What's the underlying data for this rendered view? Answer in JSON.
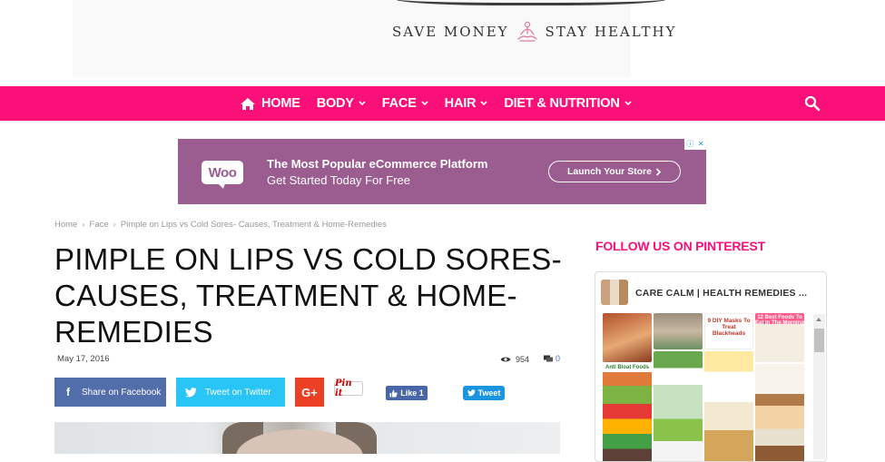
{
  "header": {
    "tagline_left": "SAVE MONEY",
    "tagline_right": "STAY HEALTHY"
  },
  "nav": {
    "items": [
      {
        "label": "HOME",
        "icon": "home-icon"
      },
      {
        "label": "BODY",
        "icon": "chevron-down-icon"
      },
      {
        "label": "FACE",
        "icon": "chevron-down-icon"
      },
      {
        "label": "HAIR",
        "icon": "chevron-down-icon"
      },
      {
        "label": "DIET & NUTRITION",
        "icon": "chevron-down-icon"
      }
    ],
    "search_icon": "search-icon",
    "color": "#fb0f78"
  },
  "ad": {
    "logo": "Woo",
    "headline": "The Most Popular eCommerce Platform",
    "sub": "Get Started Today For Free",
    "cta": "Launch Your Store",
    "color": "#9b5c8f"
  },
  "breadcrumb": [
    "Home",
    "Face",
    "Pimple on Lips vs Cold Sores- Causes, Treatment & Home-Remedies"
  ],
  "article": {
    "title": "PIMPLE ON LIPS VS COLD SORES- CAUSES, TREATMENT & HOME-REMEDIES",
    "date": "May 17, 2016",
    "views": "954",
    "comments": "0"
  },
  "share": {
    "facebook": "Share on Facebook",
    "twitter": "Tweet on Twitter",
    "gplus": "G+",
    "pinit": "Pin it",
    "like": "Like 1",
    "tweet": "Tweet"
  },
  "sidebar": {
    "heading": "FOLLOW US ON PINTEREST",
    "profile_name": "CARE CALM | HEALTH REMEDIES ...",
    "pins": [
      {
        "title": ""
      },
      {
        "title": ""
      },
      {
        "title": "9 DIY Masks To Treat Blackheads"
      },
      {
        "title": "12 Best Foods To Eat In The Morning"
      },
      {
        "title": "Anti Bloat Foods"
      },
      {
        "title": ""
      },
      {
        "title": ""
      },
      {
        "title": ""
      }
    ]
  }
}
